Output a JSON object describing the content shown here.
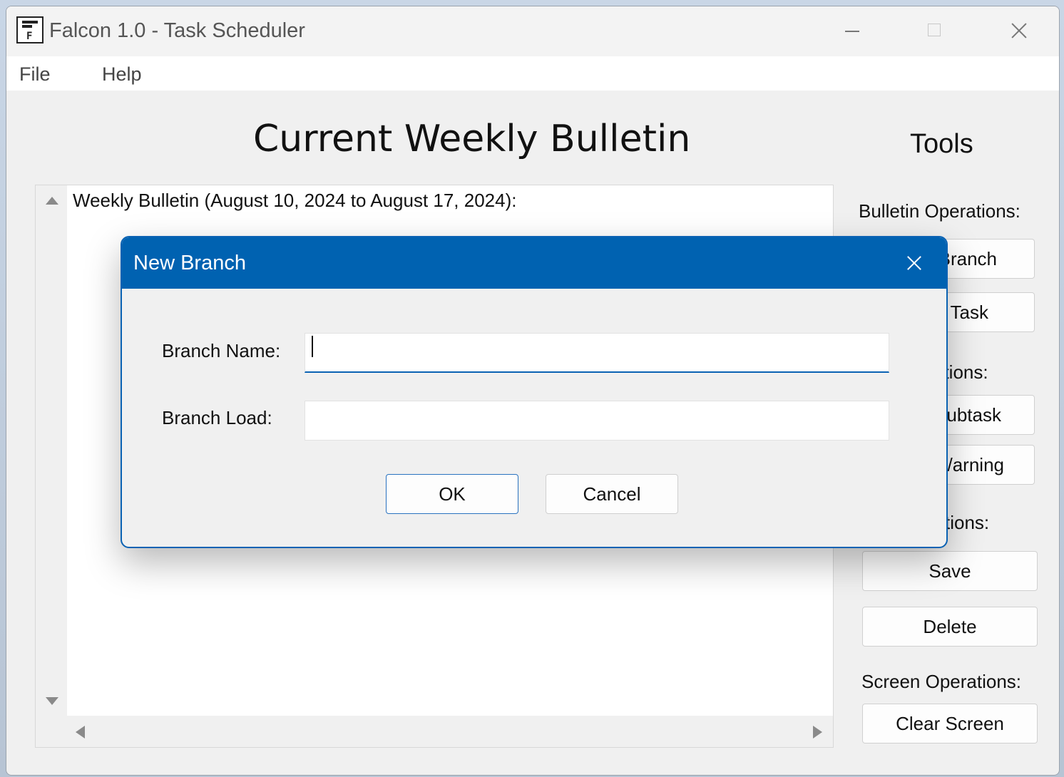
{
  "window": {
    "title": "Falcon 1.0 - Task Scheduler",
    "controls": [
      "minimize-icon",
      "maximize-icon",
      "close-icon"
    ]
  },
  "menu": {
    "items": [
      {
        "label": "File"
      },
      {
        "label": "Help"
      }
    ]
  },
  "main": {
    "heading": "Current Weekly Bulletin",
    "bulletin_text": "Weekly Bulletin (August 10, 2024 to August 17, 2024):"
  },
  "tools": {
    "title": "Tools",
    "bulletin_ops_label": "Bulletin Operations:",
    "branch_button_partial": "Branch",
    "task_button_partial": "Task",
    "task_ops_label_partial": "ations:",
    "subtask_button_partial": "ubtask",
    "warning_button_partial": "/arning",
    "file_ops_label_partial": "tions:",
    "save_label": "Save",
    "delete_label": "Delete",
    "screen_ops_label": "Screen Operations:",
    "clear_screen_label": "Clear Screen"
  },
  "dialog": {
    "title": "New Branch",
    "branch_name_label": "Branch Name:",
    "branch_name_value": "",
    "branch_load_label": "Branch Load:",
    "branch_load_value": "",
    "ok_label": "OK",
    "cancel_label": "Cancel",
    "accent_color": "#0062b1"
  }
}
